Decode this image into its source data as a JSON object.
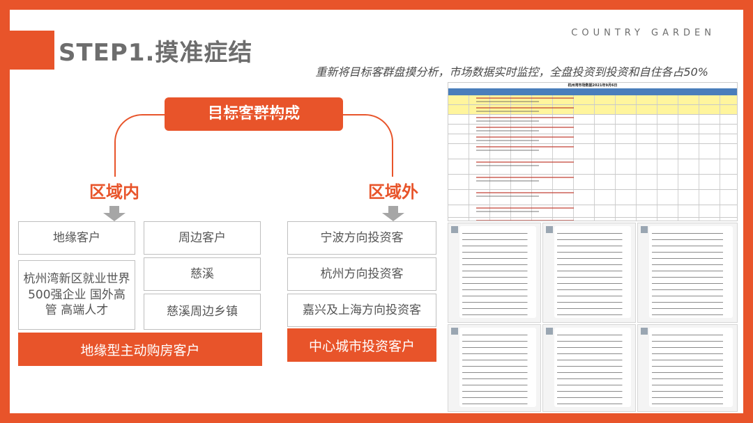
{
  "header": {
    "title": "STEP1.摸准症结",
    "brand": "COUNTRY GARDEN",
    "subtitle": "重新将目标客群盘摸分析，市场数据实时监控，全盘投资到投资和自住各占50%"
  },
  "diagram": {
    "root": "目标客群构成",
    "left": {
      "label": "区域内",
      "col1": [
        "地缘客户",
        "杭州湾新区就业世界500强企业 国外高管 高端人才"
      ],
      "col2": [
        "周边客户",
        "慈溪",
        "慈溪周边乡镇"
      ],
      "summary": "地缘型主动购房客户"
    },
    "right": {
      "label": "区域外",
      "items": [
        "宁波方向投资客",
        "杭州方向投资客",
        "嘉兴及上海方向投资客"
      ],
      "summary": "中心城市投资客户"
    }
  },
  "screenshots": {
    "sheet_title": "杭州湾市场数据2021年9月6日"
  },
  "colors": {
    "accent": "#e8542a",
    "text_gray": "#6d6d6d",
    "arrow_gray": "#a6a6a6"
  }
}
